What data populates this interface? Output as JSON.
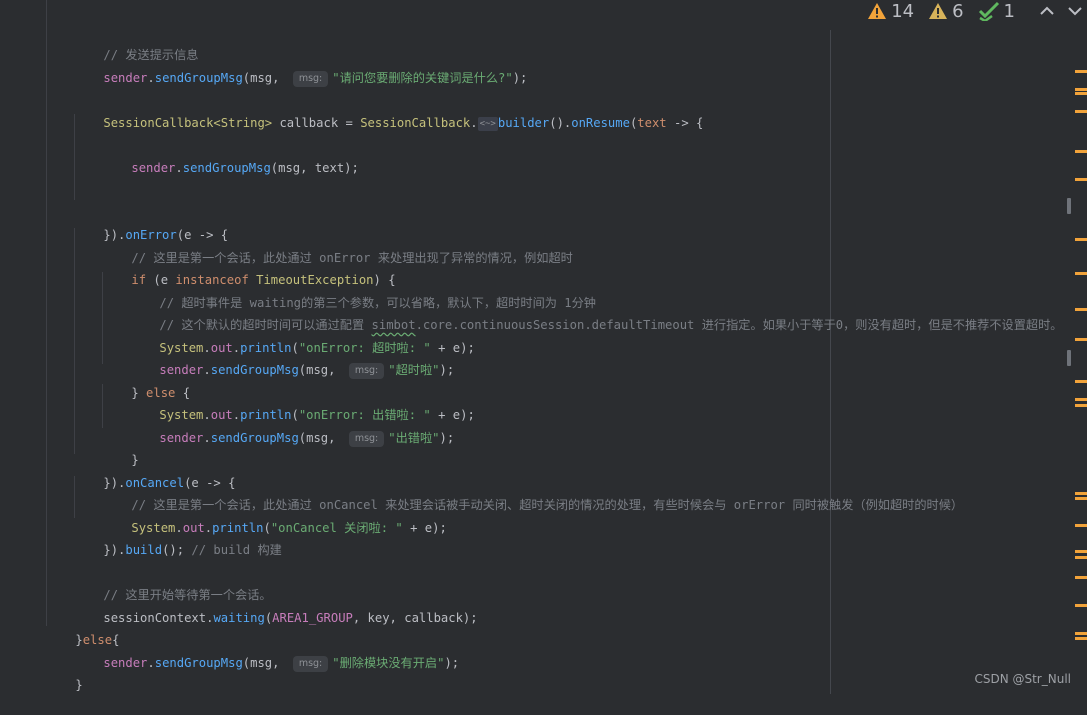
{
  "status": {
    "warnings": "14",
    "weak_warnings": "6",
    "ok": "1"
  },
  "code": {
    "l1": "// 发送提示信息",
    "l2": [
      "sender",
      "sendGroupMsg",
      "(msg, ",
      "msg:",
      "\"请问您要删除的关键词是什么?\"",
      ");"
    ],
    "l3": [
      "SessionCallback",
      "<String>",
      " callback = ",
      "SessionCallback",
      ".",
      "<~>",
      "builder",
      "().",
      "onResume",
      "(",
      "text",
      " -> {"
    ],
    "l4": [
      "sender",
      "sendGroupMsg",
      "(msg, text);"
    ],
    "l5": [
      "}).",
      "onError",
      "(e -> {"
    ],
    "l6": "// 这里是第一个会话，此处通过 onError 来处理出现了异常的情况，例如超时",
    "l7": [
      "if",
      " (e ",
      "instanceof",
      " ",
      "TimeoutException",
      ") {"
    ],
    "l8": "// 超时事件是 waiting的第三个参数，可以省略，默认下，超时时间为 1分钟",
    "l9": [
      "// 这个默认的超时时间可以通过配置 ",
      "simbot",
      ".core.continuousSession.defaultTimeout 进行指定。如果小于等于0，则没有超时，但是不推荐不设置超时。"
    ],
    "l10": [
      "System",
      ".",
      "out",
      ".",
      "println",
      "(",
      "\"onError: 超时啦: \"",
      " + e);"
    ],
    "l11": [
      "sender",
      "sendGroupMsg",
      "(msg, ",
      "msg:",
      "\"超时啦\"",
      ");"
    ],
    "l12": [
      "} ",
      "else",
      " {"
    ],
    "l13": [
      "System",
      ".",
      "out",
      ".",
      "println",
      "(",
      "\"onError: 出错啦: \"",
      " + e);"
    ],
    "l14": [
      "sender",
      "sendGroupMsg",
      "(msg, ",
      "msg:",
      "\"出错啦\"",
      ");"
    ],
    "l15": "}",
    "l16": [
      "}).",
      "onCancel",
      "(e -> {"
    ],
    "l17": "// 这里是第一个会话，此处通过 onCancel 来处理会话被手动关闭、超时关闭的情况的处理，有些时候会与 orError 同时被触发（例如超时的时候）",
    "l18": [
      "System",
      ".",
      "out",
      ".",
      "println",
      "(",
      "\"onCancel 关闭啦: \"",
      " + e);"
    ],
    "l19": [
      "}).",
      "build",
      "(); ",
      "// build 构建"
    ],
    "l20": "// 这里开始等待第一个会话。",
    "l21": [
      "sessionContext",
      ".",
      "waiting",
      "(",
      "AREA1_GROUP",
      ", key, callback);"
    ],
    "l22": [
      "}",
      "else",
      "{"
    ],
    "l23": [
      "sender",
      "sendGroupMsg",
      "(msg, ",
      "msg:",
      "\"删除模块没有开启\"",
      ");"
    ],
    "l24": "}"
  },
  "watermark": "CSDN @Str_Null",
  "colors": {
    "background": "#2b2d30",
    "comment": "#7a7e85",
    "method": "#56a8f5",
    "field": "#c77dbb",
    "string": "#6aab73",
    "keyword": "#cf8e6d",
    "type": "#c5c17c",
    "warning": "#f2a33a",
    "ok": "#5fb85f"
  },
  "icons": [
    "warning-icon",
    "weak-warning-icon",
    "checkmark-icon",
    "chevron-up-icon",
    "chevron-down-icon"
  ]
}
